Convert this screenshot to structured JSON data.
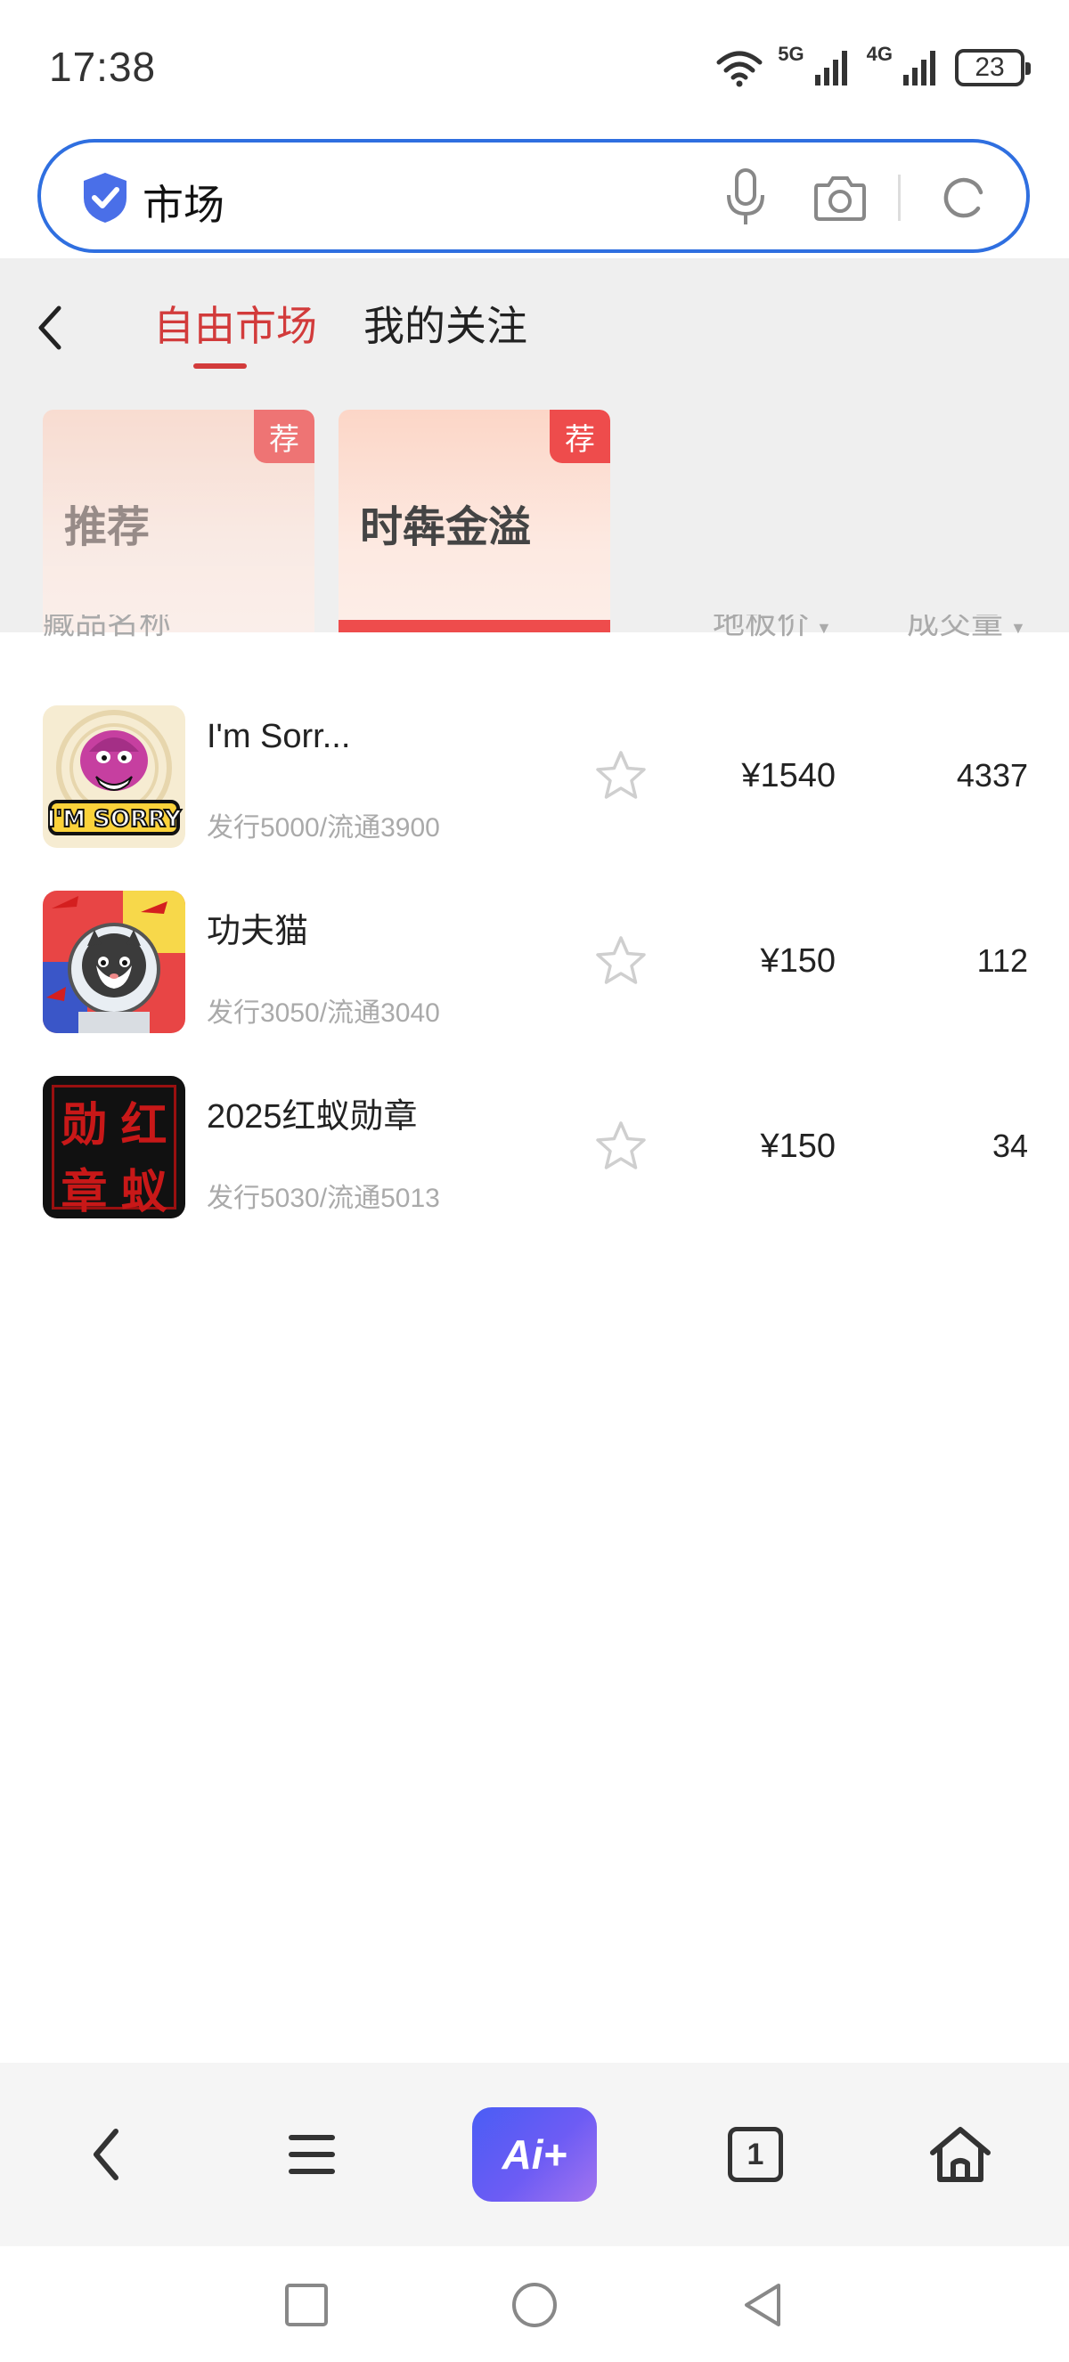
{
  "status_bar": {
    "time": "17:38",
    "network_1": "5G",
    "network_2": "4G",
    "battery": "23"
  },
  "search": {
    "query": "市场",
    "icons": [
      "shield-check-icon",
      "microphone-icon",
      "camera-icon",
      "refresh-icon"
    ]
  },
  "tabs": [
    {
      "label": "自由市场",
      "active": true
    },
    {
      "label": "我的关注",
      "active": false
    }
  ],
  "categories": [
    {
      "label": "推荐",
      "badge": "荐"
    },
    {
      "label": "时犇金溢",
      "badge": "荐"
    }
  ],
  "table_header": {
    "name": "藏品名称",
    "price": "地板价",
    "volume": "成交量"
  },
  "items": [
    {
      "name": "I'm Sorr...",
      "sub": "发行5000/流通3900",
      "price": "¥1540",
      "volume": "4337"
    },
    {
      "name": "功夫猫",
      "sub": "发行3050/流通3040",
      "price": "¥150",
      "volume": "112"
    },
    {
      "name": "2025红蚁勋章",
      "sub": "发行5030/流通5013",
      "price": "¥150",
      "volume": "34"
    }
  ],
  "thumb3_text": [
    "勋",
    "红",
    "章",
    "蚁"
  ],
  "bottom_bar": {
    "ai_label": "Ai+",
    "tab_count": "1"
  },
  "colors": {
    "accent_red": "#d23b3b",
    "search_border": "#2f6fe0",
    "ai_gradient_start": "#4a5df5",
    "ai_gradient_end": "#a374ef"
  }
}
